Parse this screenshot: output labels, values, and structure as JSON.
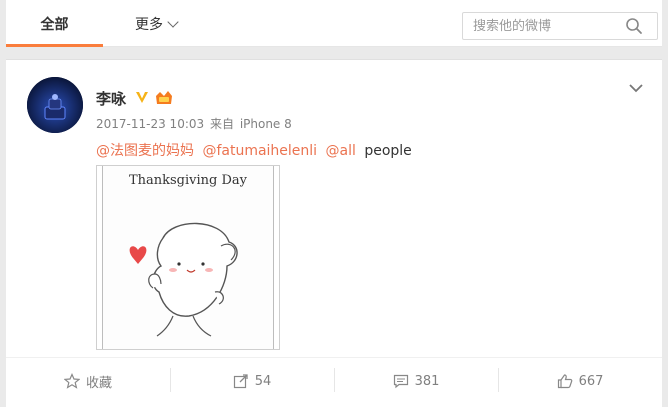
{
  "tabs": {
    "all": "全部",
    "more": "更多"
  },
  "search": {
    "placeholder": "搜索他的微博"
  },
  "post": {
    "username": "李咏",
    "date": "2017-11-23 10:03",
    "source_prefix": "来自",
    "source": "iPhone 8",
    "mentions": [
      "@法图麦的妈妈",
      "@fatumaihelenli",
      "@all"
    ],
    "text_suffix": "people",
    "image_title": "Thanksgiving Day"
  },
  "actions": {
    "favorite": "收藏",
    "repost": "54",
    "comment": "381",
    "like": "667"
  },
  "colors": {
    "accent": "#fa7d3c",
    "mention": "#eb7350",
    "verified": "#f6b318"
  }
}
